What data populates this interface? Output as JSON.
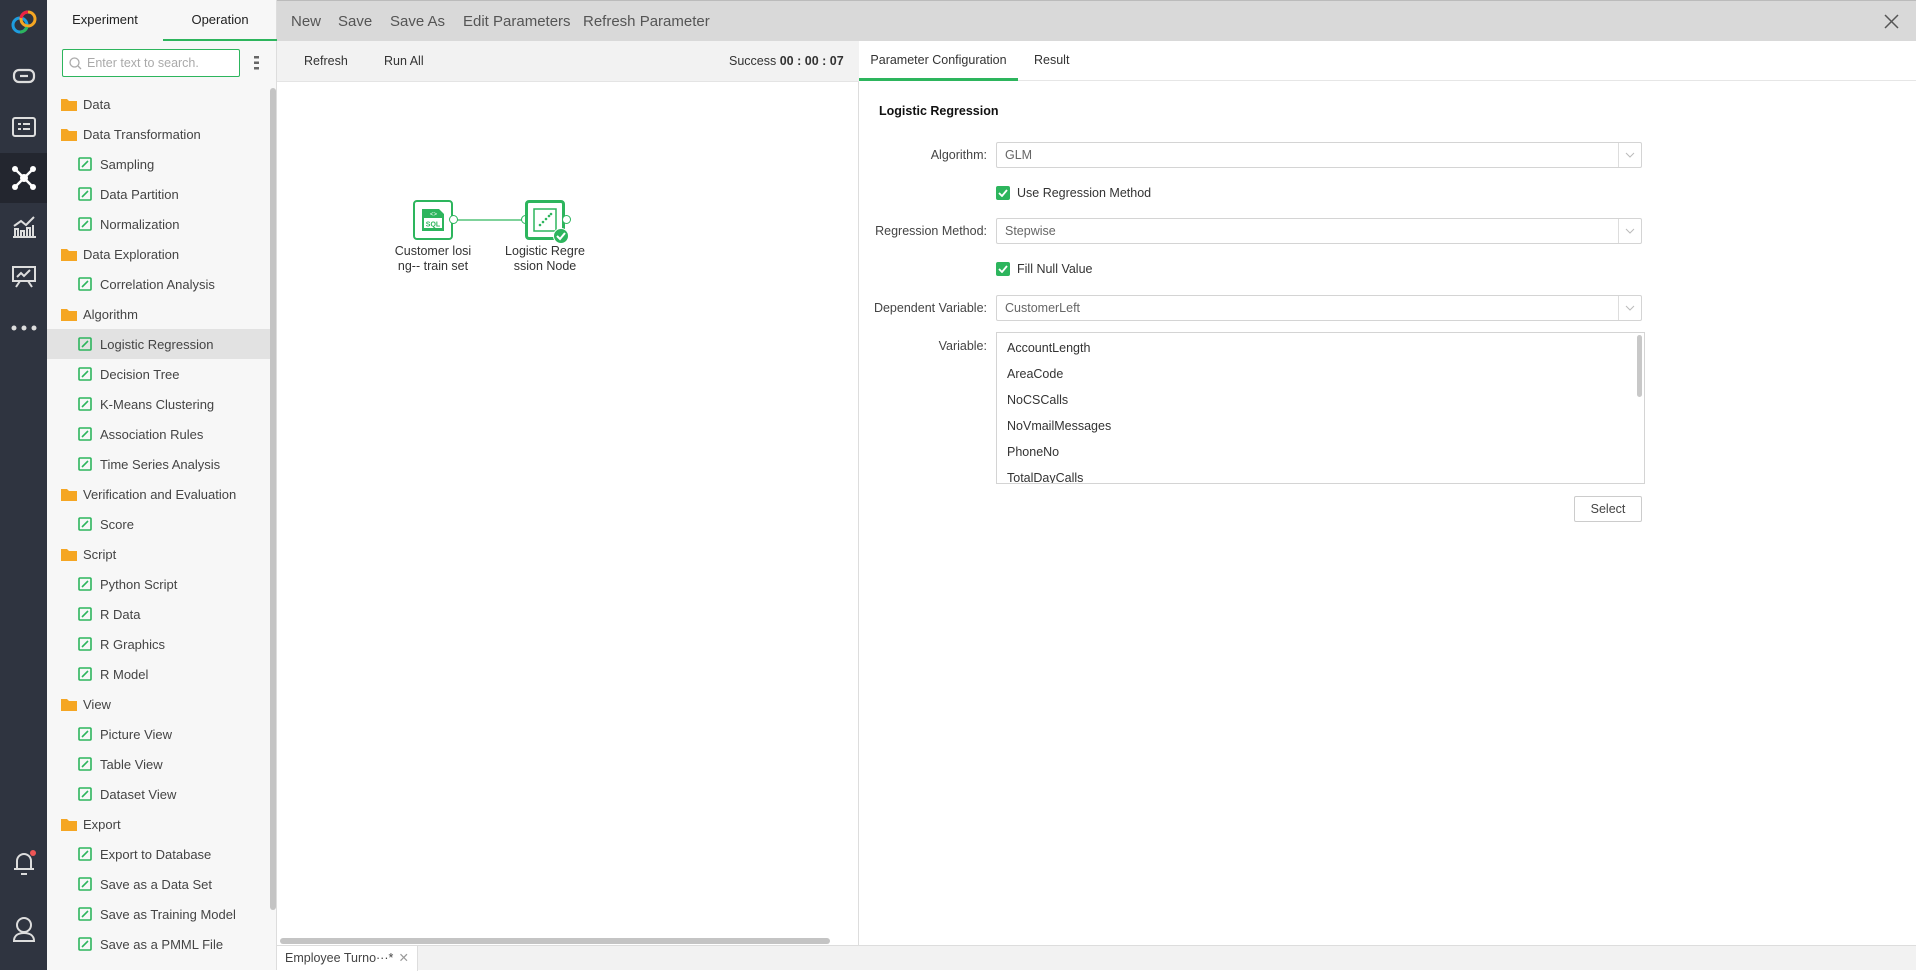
{
  "rail": {
    "items": [
      {
        "icon": "logo-icon"
      },
      {
        "icon": "link-icon"
      },
      {
        "icon": "list-card-icon"
      },
      {
        "icon": "network-nodes-icon",
        "active": true
      },
      {
        "icon": "bar-line-chart-icon"
      },
      {
        "icon": "presentation-chart-icon"
      },
      {
        "icon": "more-dots-icon"
      }
    ],
    "bottom": [
      {
        "icon": "bell-icon",
        "badge": true
      },
      {
        "icon": "user-icon"
      }
    ]
  },
  "sidebar": {
    "tabs": [
      {
        "label": "Experiment"
      },
      {
        "label": "Operation",
        "active": true
      }
    ],
    "search_placeholder": "Enter text to search.",
    "items": [
      {
        "label": "Data",
        "type": "folder"
      },
      {
        "label": "Data Transformation",
        "type": "folder"
      },
      {
        "label": "Sampling",
        "icon": "sampling-icon"
      },
      {
        "label": "Data Partition",
        "icon": "data-partition-icon"
      },
      {
        "label": "Normalization",
        "icon": "normalization-icon"
      },
      {
        "label": "Data Exploration",
        "type": "folder"
      },
      {
        "label": "Correlation Analysis",
        "icon": "correlation-icon"
      },
      {
        "label": "Algorithm",
        "type": "folder"
      },
      {
        "label": "Logistic Regression",
        "icon": "logistic-regression-icon",
        "selected": true
      },
      {
        "label": "Decision Tree",
        "icon": "decision-tree-icon"
      },
      {
        "label": "K-Means Clustering",
        "icon": "kmeans-icon"
      },
      {
        "label": "Association Rules",
        "icon": "association-icon"
      },
      {
        "label": "Time Series Analysis",
        "icon": "time-series-icon"
      },
      {
        "label": "Verification and Evaluation",
        "type": "folder"
      },
      {
        "label": "Score",
        "icon": "score-icon"
      },
      {
        "label": "Script",
        "type": "folder"
      },
      {
        "label": "Python Script",
        "icon": "python-script-icon"
      },
      {
        "label": "R Data",
        "icon": "r-data-icon"
      },
      {
        "label": "R Graphics",
        "icon": "r-graphics-icon"
      },
      {
        "label": "R Model",
        "icon": "r-model-icon"
      },
      {
        "label": "View",
        "type": "folder"
      },
      {
        "label": "Picture View",
        "icon": "picture-view-icon"
      },
      {
        "label": "Table View",
        "icon": "table-view-icon"
      },
      {
        "label": "Dataset View",
        "icon": "dataset-view-icon"
      },
      {
        "label": "Export",
        "type": "folder"
      },
      {
        "label": "Export to Database",
        "icon": "export-database-icon"
      },
      {
        "label": "Save as a Data Set",
        "icon": "save-dataset-icon"
      },
      {
        "label": "Save as Training Model",
        "icon": "save-model-icon"
      },
      {
        "label": "Save as a PMML File",
        "icon": "pmml-file-icon"
      }
    ]
  },
  "toolbar": {
    "items": [
      "New",
      "Save",
      "Save As",
      "Edit Parameters",
      "Refresh Parameter"
    ]
  },
  "canvas_toolbar": {
    "refresh": "Refresh",
    "run_all": "Run All",
    "status": "Success",
    "time": "00 : 00 : 07"
  },
  "canvas": {
    "nodes": [
      {
        "label1": "Customer losi",
        "label2": "ng-- train set",
        "icon": "sql-file-icon"
      },
      {
        "label1": "Logistic Regre",
        "label2": "ssion Node",
        "icon": "logistic-regression-icon",
        "status": "success"
      }
    ]
  },
  "panel": {
    "tabs": [
      {
        "label": "Parameter Configuration",
        "active": true
      },
      {
        "label": "Result"
      }
    ],
    "title": "Logistic Regression",
    "algorithm": {
      "label": "Algorithm:",
      "value": "GLM"
    },
    "use_regression": {
      "label": "Use Regression Method",
      "checked": true
    },
    "regression_method": {
      "label": "Regression Method:",
      "value": "Stepwise"
    },
    "fill_null": {
      "label": "Fill Null Value",
      "checked": true
    },
    "dependent": {
      "label": "Dependent Variable:",
      "value": "CustomerLeft"
    },
    "variable": {
      "label": "Variable:",
      "items": [
        "AccountLength",
        "AreaCode",
        "NoCSCalls",
        "NoVmailMessages",
        "PhoneNo",
        "TotalDayCalls"
      ]
    },
    "select_button": "Select"
  },
  "bottom_tabs": [
    {
      "label": "Employee Turno···*"
    }
  ],
  "colors": {
    "accent": "#2db55d",
    "folder": "#f5a623",
    "rail": "#2f3440"
  }
}
